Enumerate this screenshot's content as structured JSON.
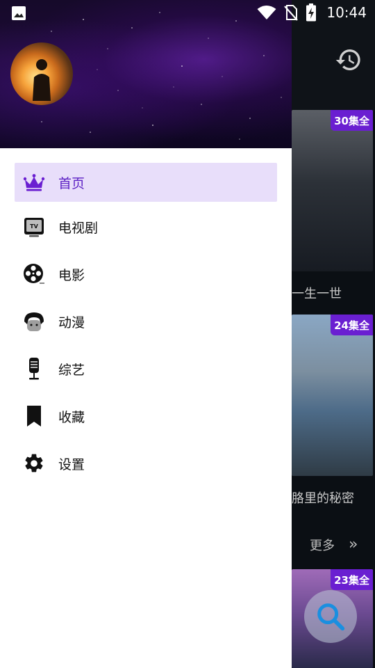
{
  "status_bar": {
    "time": "10:44",
    "icons": [
      "photo-icon",
      "wifi-icon",
      "no-sim-icon",
      "battery-charging-icon"
    ]
  },
  "background_app": {
    "history_icon": "history-icon",
    "cards": [
      {
        "badge": "30集全",
        "title": "一生一世"
      },
      {
        "badge": "24集全",
        "title": "胳里的秘密"
      },
      {
        "badge": "23集全"
      }
    ],
    "more_label": "更多",
    "more_chevron": "»",
    "fab_icon": "search-icon"
  },
  "drawer": {
    "avatar": "avatar-sunset",
    "menu_items": [
      {
        "label": "首页",
        "icon": "crown-icon",
        "active": true
      },
      {
        "label": "电视剧",
        "icon": "tv-icon",
        "active": false
      },
      {
        "label": "电影",
        "icon": "film-reel-icon",
        "active": false
      },
      {
        "label": "动漫",
        "icon": "anime-icon",
        "active": false
      },
      {
        "label": "综艺",
        "icon": "microphone-icon",
        "active": false
      },
      {
        "label": "收藏",
        "icon": "bookmark-icon",
        "active": false
      },
      {
        "label": "设置",
        "icon": "gear-icon",
        "active": false
      }
    ]
  },
  "colors": {
    "accent": "#5b1fc4",
    "active_bg": "#e8defa",
    "badge_bg": "#6a1fd1"
  }
}
